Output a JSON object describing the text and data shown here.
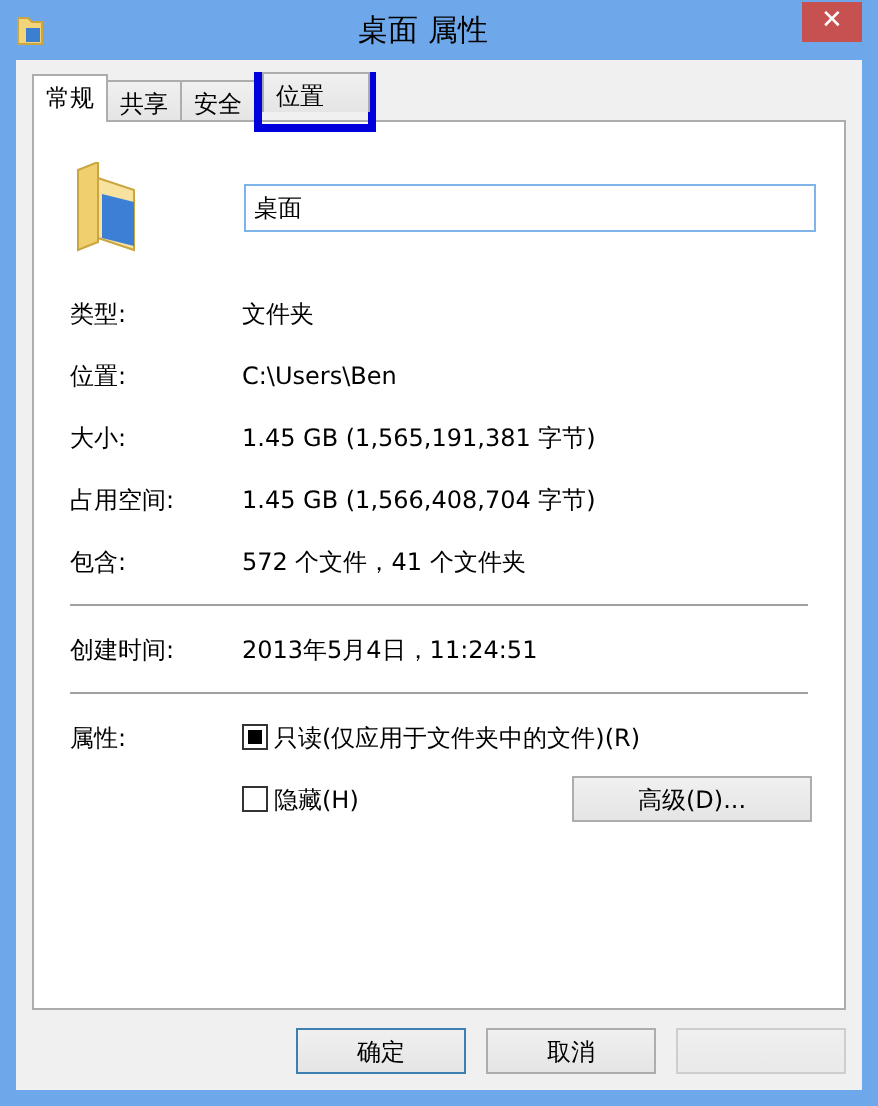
{
  "window": {
    "title": "桌面 属性",
    "close_button": "✕"
  },
  "tabs": [
    {
      "label": "常规",
      "selected": true,
      "highlighted": false
    },
    {
      "label": "共享",
      "selected": false,
      "highlighted": false
    },
    {
      "label": "安全",
      "selected": false,
      "highlighted": false
    },
    {
      "label": "位置",
      "selected": false,
      "highlighted": true
    }
  ],
  "name_field": {
    "value": "桌面"
  },
  "info_groups": [
    [
      {
        "label": "类型:",
        "value": "文件夹"
      },
      {
        "label": "位置:",
        "value": "C:\\Users\\Ben"
      },
      {
        "label": "大小:",
        "value": "1.45 GB (1,565,191,381 字节)"
      },
      {
        "label": "占用空间:",
        "value": "1.45 GB (1,566,408,704 字节)"
      },
      {
        "label": "包含:",
        "value": "572 个文件，41 个文件夹"
      }
    ],
    [
      {
        "label": "创建时间:",
        "value": "2013年5月4日，11:24:51"
      }
    ]
  ],
  "attributes": {
    "label": "属性:",
    "options": [
      {
        "label": "只读(仅应用于文件夹中的文件)(R)",
        "checked": false,
        "mixed": true
      },
      {
        "label": "隐藏(H)",
        "checked": false,
        "mixed": false
      }
    ],
    "advanced_button": "高级(D)..."
  },
  "buttons": [
    {
      "label": "确定",
      "kind": "default"
    },
    {
      "label": "取消",
      "kind": "normal"
    },
    {
      "kind": "blank"
    }
  ]
}
